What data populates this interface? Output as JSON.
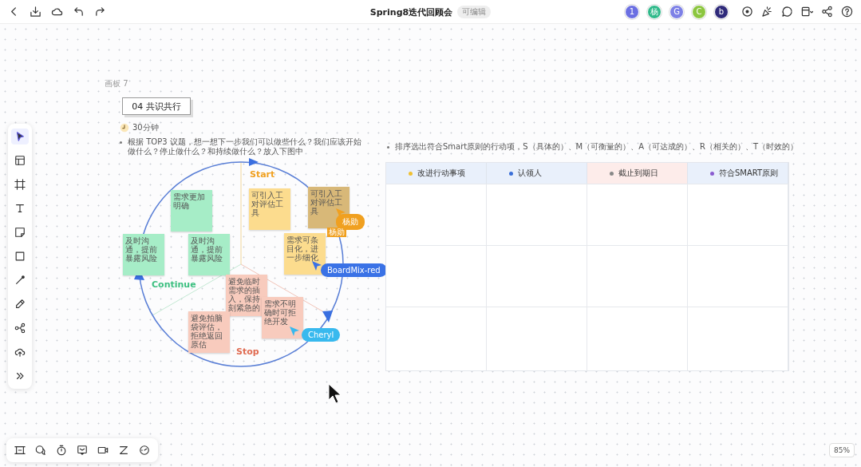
{
  "top_bar": {
    "title": "Spring8迭代回顾会",
    "badge": "可编辑",
    "avatars": [
      {
        "initial": "1",
        "color": "#6b6fe2"
      },
      {
        "initial": "杨",
        "color": "#2fb98a"
      },
      {
        "initial": "G",
        "color": "#7d80e6"
      },
      {
        "initial": "C",
        "color": "#8cc63f"
      },
      {
        "initial": "b",
        "color": "#2f2a7a"
      }
    ]
  },
  "left_toolbar": [
    {
      "kind": "select",
      "selected": true
    },
    {
      "kind": "template",
      "selected": false
    },
    {
      "kind": "frame",
      "selected": false
    },
    {
      "kind": "text",
      "selected": false
    },
    {
      "kind": "sticky",
      "selected": false
    },
    {
      "kind": "shape",
      "selected": false
    },
    {
      "kind": "line",
      "selected": false
    },
    {
      "kind": "pen",
      "selected": false
    },
    {
      "kind": "mindmap",
      "selected": false
    },
    {
      "kind": "upload",
      "selected": false
    },
    {
      "kind": "more",
      "selected": false
    }
  ],
  "board": {
    "label": "画板 7",
    "title": "04 共识共行",
    "duration": "30分钟",
    "prompt": "根据 TOP3 议题，想一想下一步我们可以做些什么？我们应该开始做什么？停止做什么？和持续做什么？放入下图中",
    "sections": [
      {
        "label": "Start",
        "color": "#f0a020"
      },
      {
        "label": "Continue",
        "color": "#3cbf80"
      },
      {
        "label": "Stop",
        "color": "#e06a50"
      }
    ],
    "stickies": [
      {
        "text": "需求更加明确",
        "color": "#a6edc7"
      },
      {
        "text": "及时沟通，提前暴露风险",
        "color": "#a6edc7"
      },
      {
        "text": "及时沟通，提前暴露风险",
        "color": "#a6edc7"
      },
      {
        "text": "可引入工对评估工具",
        "color": "#fcdc8e"
      },
      {
        "text": "可引入工对评估工具",
        "color": "#d8b878"
      },
      {
        "text": "需求可条目化，进一步细化",
        "color": "#fcdc8e"
      },
      {
        "text": "避免临时需求的插入，保持刻紧急的",
        "color": "#f8cbbd"
      },
      {
        "text": "避免拍脑袋评估，拒绝返回原估",
        "color": "#f8cbbd"
      },
      {
        "text": "需求不明确时可拒绝开发",
        "color": "#f8cbbd"
      }
    ],
    "cursors": [
      {
        "name": "杨勋",
        "color": "#f0a020",
        "tag": "杨勋"
      },
      {
        "name": "BoardMix-red",
        "color": "#3a72e6"
      },
      {
        "name": "Cheryl",
        "color": "#38b9ee"
      }
    ]
  },
  "smart": {
    "prompt": "排序选出符合Smart原则的行动项，S（具体的）、M（可衡量的）、A（可达成的）、R（相关的）、T（时效的）",
    "columns": [
      {
        "label": "改进行动事项",
        "color": "#f0c030",
        "highlighted": false
      },
      {
        "label": "认领人",
        "color": "#3a6fd8",
        "highlighted": false
      },
      {
        "label": "截止到期日",
        "color": "#888888",
        "highlighted": true
      },
      {
        "label": "符合SMART原则",
        "color": "#8a5cd0",
        "highlighted": false
      }
    ]
  },
  "zoom": "85%"
}
